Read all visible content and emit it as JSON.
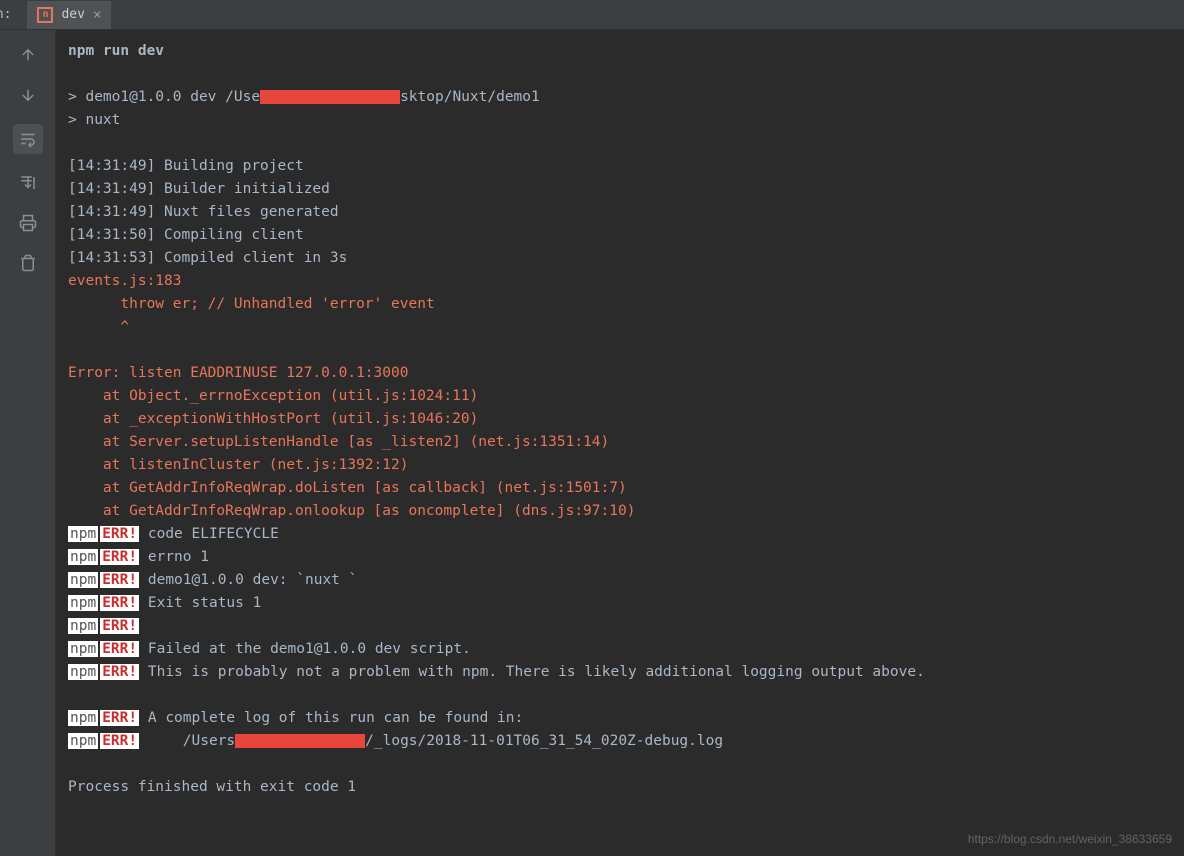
{
  "topbar": {
    "run_label": "un:",
    "tab": {
      "label": "dev",
      "close": "×"
    }
  },
  "terminal": {
    "cmd": "npm run dev",
    "spawn_prefix": "> demo1@1.0.0 dev /Use",
    "spawn_mid": "sktop/Nuxt/demo1",
    "spawn_nuxt": "> nuxt",
    "build_lines": [
      "[14:31:49] Building project",
      "[14:31:49] Builder initialized",
      "[14:31:49] Nuxt files generated",
      "[14:31:50] Compiling client",
      "[14:31:53] Compiled client in 3s"
    ],
    "events_header": "events.js:183",
    "events_throw": "      throw er; // Unhandled 'error' event",
    "events_caret": "      ^",
    "error_title": "Error: listen EADDRINUSE 127.0.0.1:3000",
    "stack": [
      "    at Object._errnoException (util.js:1024:11)",
      "    at _exceptionWithHostPort (util.js:1046:20)",
      "    at Server.setupListenHandle [as _listen2] (net.js:1351:14)",
      "    at listenInCluster (net.js:1392:12)",
      "    at GetAddrInfoReqWrap.doListen [as callback] (net.js:1501:7)",
      "    at GetAddrInfoReqWrap.onlookup [as oncomplete] (dns.js:97:10)"
    ],
    "npm_label": "npm",
    "err_label": "ERR!",
    "npm_lines": [
      " code ELIFECYCLE",
      " errno 1",
      " demo1@1.0.0 dev: `nuxt `",
      " Exit status 1",
      "",
      " Failed at the demo1@1.0.0 dev script.",
      " This is probably not a problem with npm. There is likely additional logging output above."
    ],
    "log_intro": " A complete log of this run can be found in:",
    "log_prefix": "     /Users",
    "log_suffix": "/_logs/2018-11-01T06_31_54_020Z-debug.log",
    "finished": "Process finished with exit code 1"
  },
  "watermark": "https://blog.csdn.net/weixin_38633659"
}
